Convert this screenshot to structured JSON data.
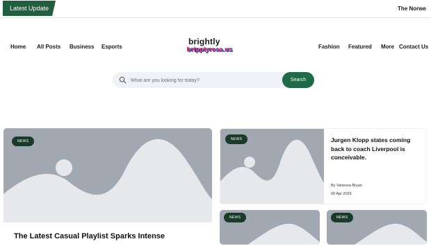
{
  "topbar": {
    "latest_label": "Latest Update",
    "ticker_text": "The Norwe"
  },
  "nav": {
    "left": [
      "Home",
      "All Posts",
      "Business",
      "Esports"
    ],
    "right": [
      "Fashion",
      "Featured",
      "More",
      "Contact Us"
    ]
  },
  "logo": {
    "line1": "brightly",
    "line2": "brippiyreaa.us"
  },
  "search": {
    "placeholder": "What are you looking for today?",
    "button_label": "Search"
  },
  "cards": {
    "main": {
      "badge": "NEWS",
      "title": "The Latest Casual Playlist Sparks Intense"
    },
    "right_top": {
      "badge": "NEWS",
      "title": "Jurgen Klopp states coming back to coach Liverpool is conceivable.",
      "author": "By Vanessa Bryan",
      "date": "08 Apr 2026"
    },
    "bottom_left": {
      "badge": "NEWS"
    },
    "bottom_right": {
      "badge": "NEWS"
    }
  },
  "colors": {
    "brand_green": "#1f6b47",
    "dark_green": "#1f5f3d",
    "placeholder_gray": "#a2a8b1"
  }
}
